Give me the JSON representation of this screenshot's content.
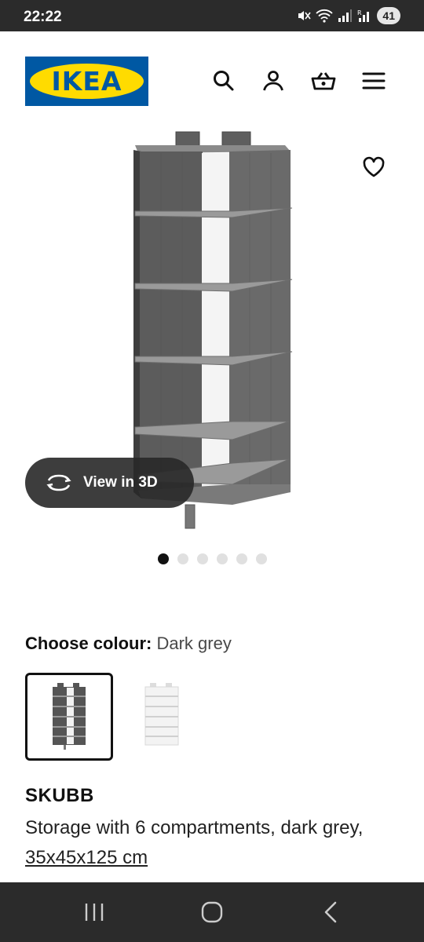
{
  "status_bar": {
    "time": "22:22",
    "battery_level": "41",
    "icons": [
      "mute-icon",
      "wifi-icon",
      "signal-icon",
      "signal-r-icon"
    ]
  },
  "header": {
    "logo_text": "IKEA",
    "icons": [
      "search-icon",
      "account-icon",
      "basket-icon",
      "menu-icon"
    ],
    "brand_blue": "#0058a3",
    "brand_yellow": "#ffdb00"
  },
  "gallery": {
    "view_3d_label": "View in 3D",
    "image_count": 6,
    "active_index": 0
  },
  "colour": {
    "label": "Choose colour:",
    "value": "Dark grey",
    "options": [
      "Dark grey",
      "White"
    ],
    "selected": "Dark grey"
  },
  "product": {
    "name": "SKUBB",
    "desc_prefix": "Storage with 6 compartments, dark grey, ",
    "dimensions": "35x45x125 cm"
  },
  "nav_bar": {
    "buttons": [
      "recent-apps-icon",
      "home-icon",
      "back-icon"
    ]
  }
}
